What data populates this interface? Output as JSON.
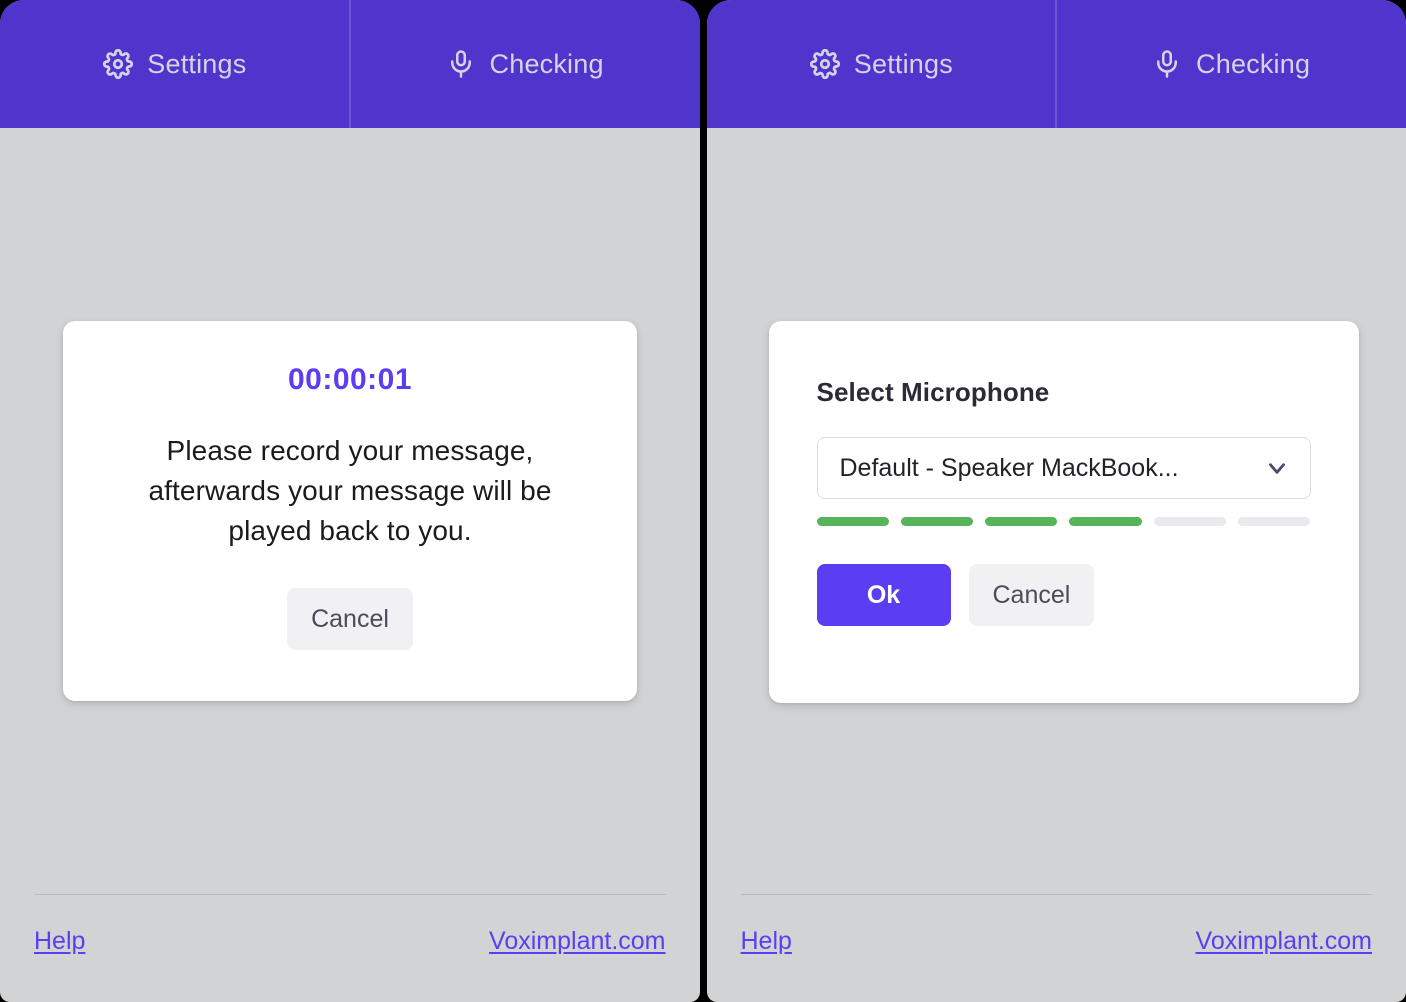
{
  "app": {
    "panels": [
      {
        "id": "left",
        "tabs": [
          {
            "icon": "gear-icon",
            "label": "Settings",
            "active": false
          },
          {
            "icon": "microphone-icon",
            "label": "Checking",
            "active": true
          }
        ],
        "dialog": {
          "kind": "recording",
          "timer": "00:00:01",
          "message": "Please record your message, afterwards your message will be played back to you.",
          "cancel_label": "Cancel"
        },
        "footer": {
          "help_label": "Help",
          "site_label": "Voximplant.com"
        }
      },
      {
        "id": "right",
        "tabs": [
          {
            "icon": "gear-icon",
            "label": "Settings",
            "active": false
          },
          {
            "icon": "microphone-icon",
            "label": "Checking",
            "active": true
          }
        ],
        "dialog": {
          "kind": "select-microphone",
          "title": "Select Microphone",
          "select_value": "Default - Speaker MackBook...",
          "chevron_icon": "chevron-down-icon",
          "level_meter": {
            "total_bars": 6,
            "active_bars": 4,
            "active_color": "#57b45b",
            "inactive_color": "#e9e9ee"
          },
          "ok_label": "Ok",
          "cancel_label": "Cancel"
        },
        "footer": {
          "help_label": "Help",
          "site_label": "Voximplant.com"
        }
      }
    ],
    "colors": {
      "brand_purple": "#4f35cb",
      "accent_purple": "#5b3ef2",
      "panel_background": "#d2d3d5",
      "card_background": "#ffffff",
      "tab_text": "#d6d3e6",
      "level_green": "#57b45b",
      "link_purple": "#5b3ef2"
    }
  }
}
